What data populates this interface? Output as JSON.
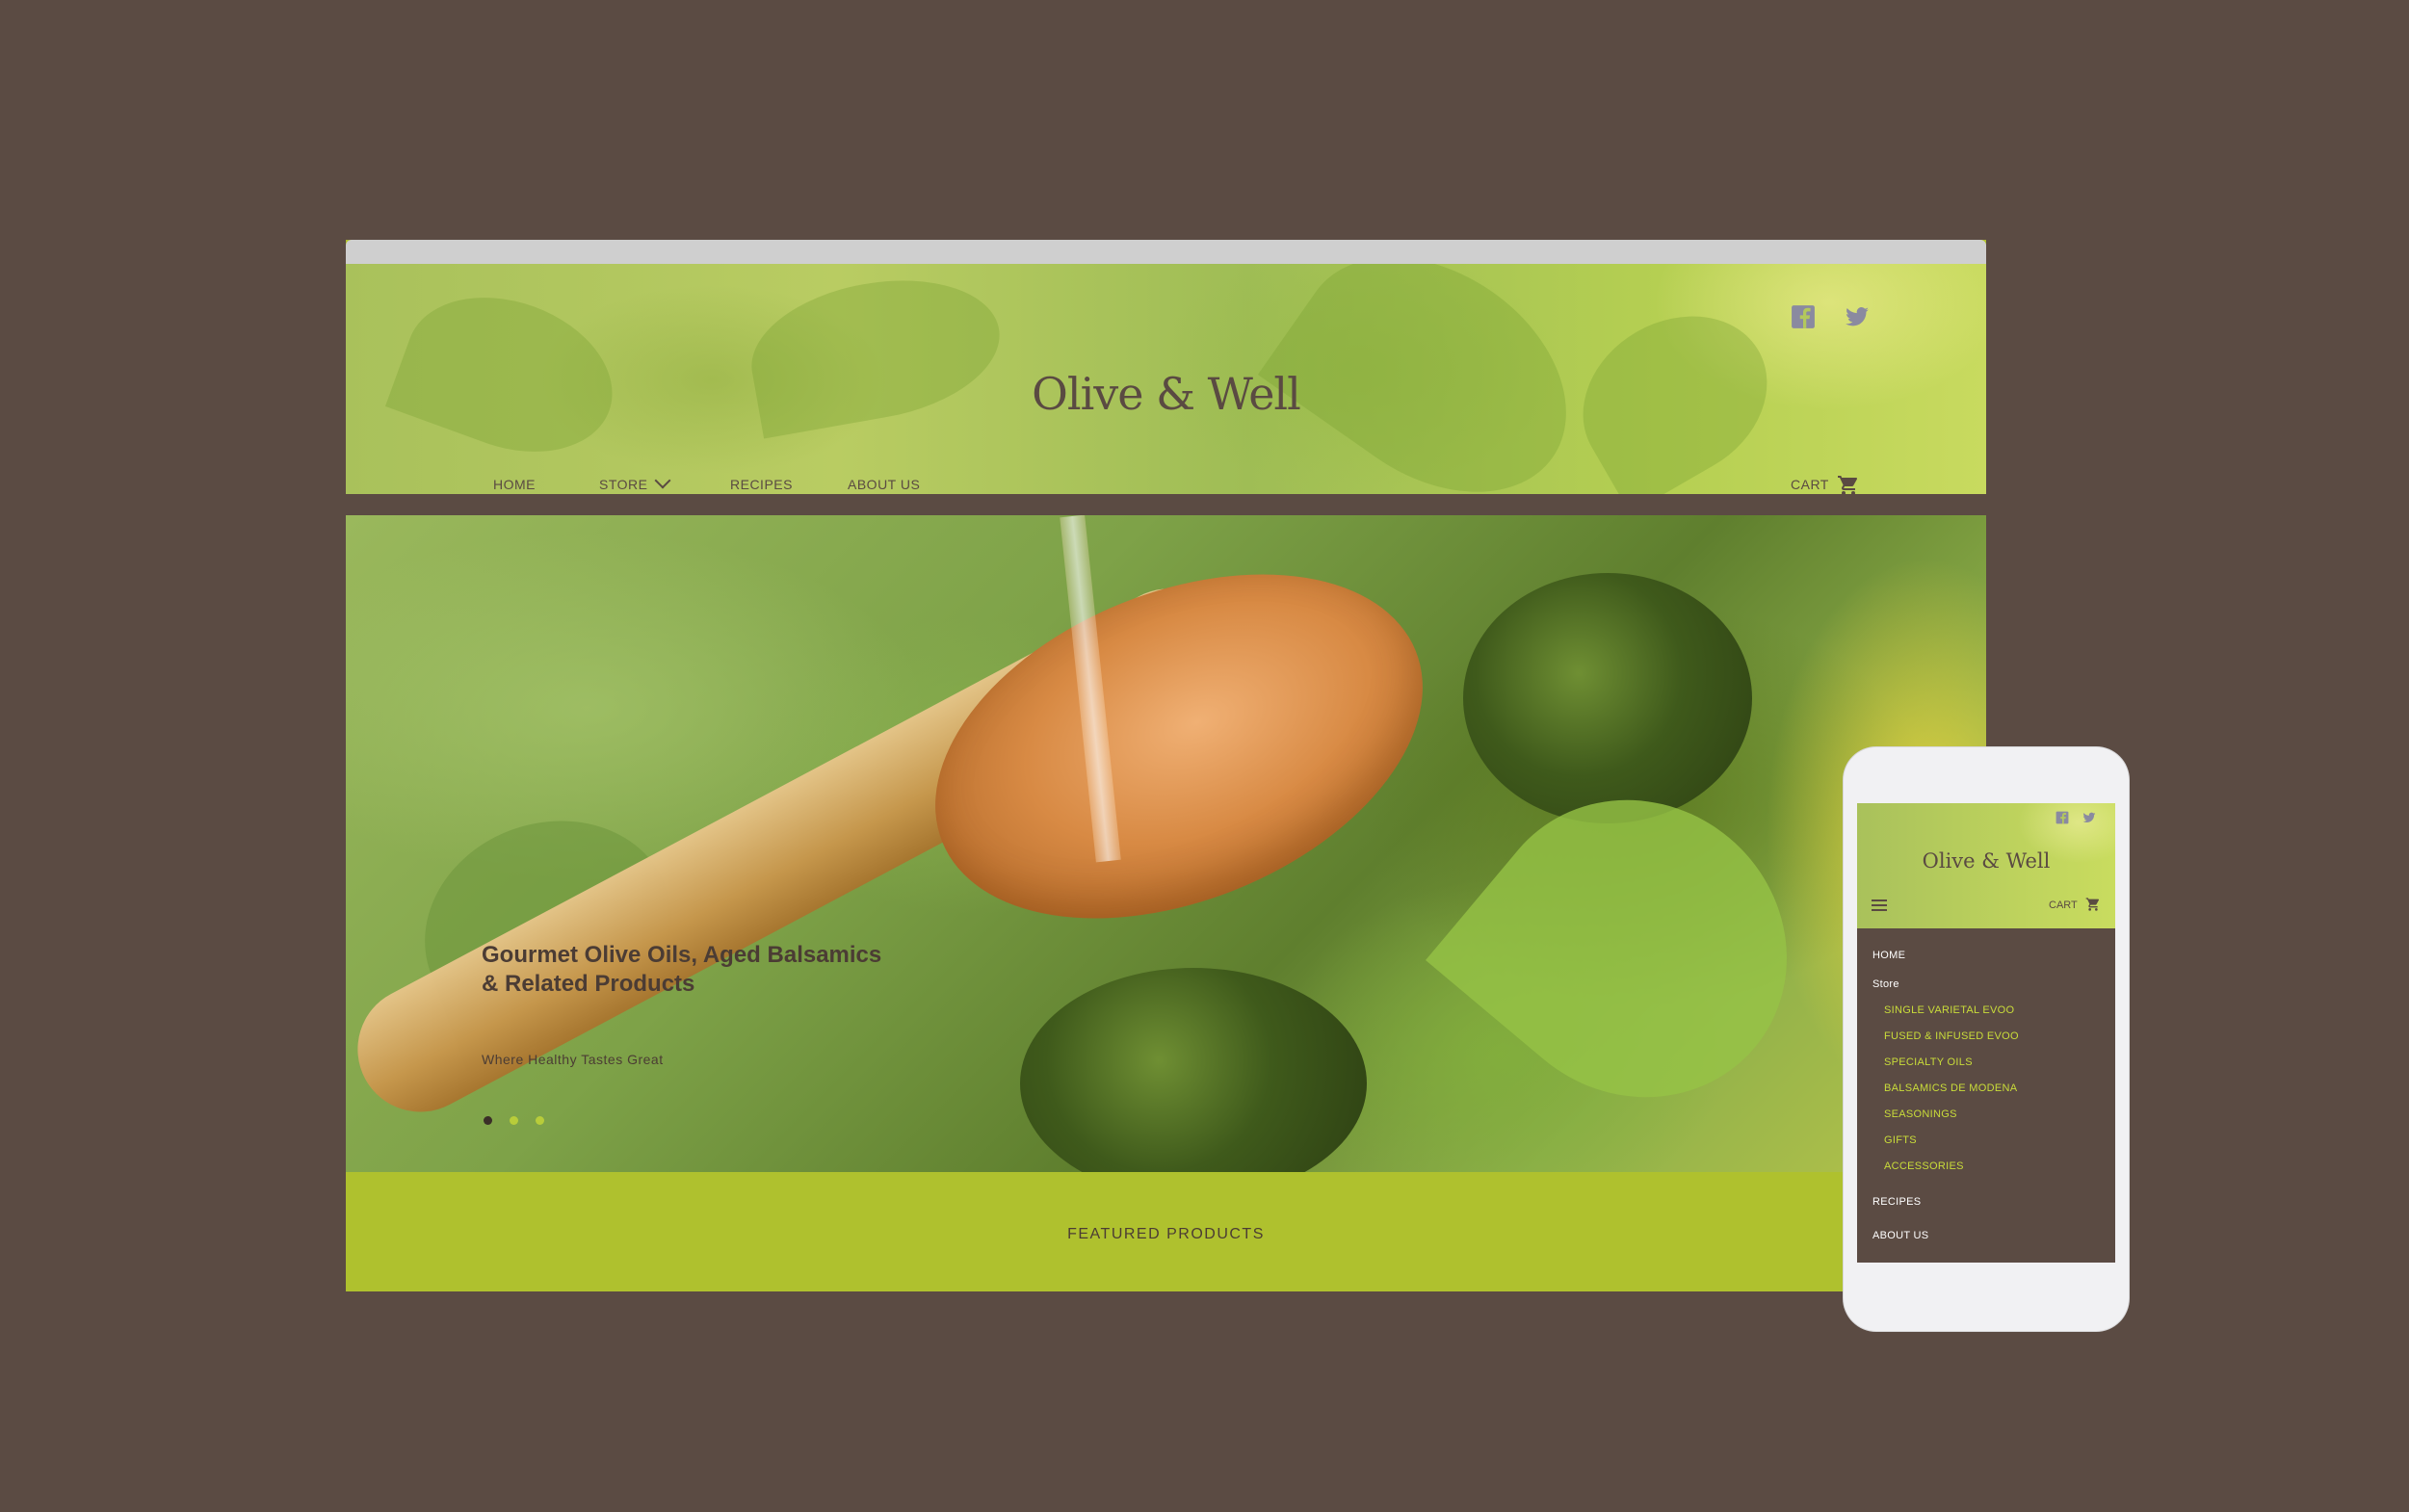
{
  "colors": {
    "page_background": "#5b4b43",
    "accent_green": "#afc12e",
    "text_brown": "#4b3c34",
    "phone_submenu": "#c9dc3a"
  },
  "desktop": {
    "brand": "Olive & Well",
    "social": [
      "facebook-icon",
      "twitter-icon"
    ],
    "nav": {
      "home": "HOME",
      "store": "STORE",
      "recipes": "RECIPES",
      "about": "ABOUT US",
      "cart": "CART"
    },
    "hero": {
      "headline": "Gourmet Olive Oils, Aged Balsamics & Related Products",
      "subheadline": "Where Healthy Tastes Great",
      "carousel_dots": 3,
      "active_dot": 1
    },
    "featured_label": "FEATURED PRODUCTS"
  },
  "mobile": {
    "brand": "Olive & Well",
    "cart": "CART",
    "menu": {
      "home": "HOME",
      "store": "Store",
      "store_items": [
        "SINGLE VARIETAL EVOO",
        "FUSED & INFUSED EVOO",
        "SPECIALTY OILS",
        "BALSAMICS DE MODENA",
        "SEASONINGS",
        "GIFTS",
        "ACCESSORIES"
      ],
      "recipes": "RECIPES",
      "about": "ABOUT US"
    }
  }
}
